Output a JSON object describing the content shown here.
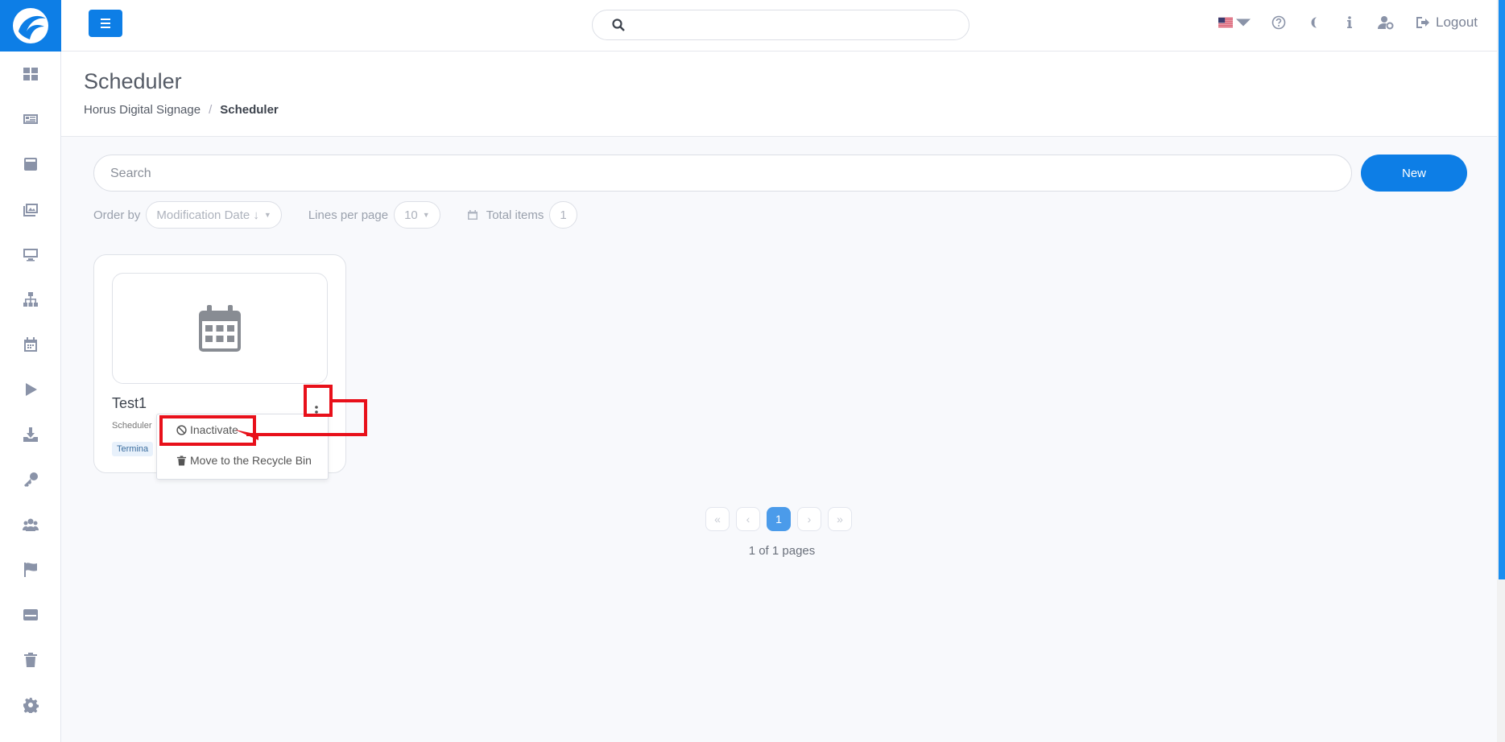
{
  "sidebar": {
    "items": [
      "dashboard-icon",
      "news-icon",
      "layout-icon",
      "media-icon",
      "monitor-icon",
      "sitemap-icon",
      "calendar-icon",
      "play-icon",
      "download-icon",
      "key-icon",
      "users-icon",
      "flag-icon",
      "card-icon",
      "trash-icon",
      "gear-icon"
    ]
  },
  "topbar": {
    "search_placeholder": "",
    "logout_label": "Logout"
  },
  "header": {
    "title": "Scheduler",
    "breadcrumb": [
      "Horus Digital Signage",
      "Scheduler"
    ],
    "breadcrumb_sep": "/"
  },
  "toolbar": {
    "search_placeholder": "Search",
    "new_label": "New",
    "order_by_label": "Order by",
    "order_by_value": "Modification Date ↓",
    "lines_label": "Lines per page",
    "lines_value": "10",
    "total_label": "Total items",
    "total_value": "1"
  },
  "card": {
    "title": "Test1",
    "subtitle": "Scheduler",
    "tag": "Termina"
  },
  "dropdown": {
    "inactivate": "Inactivate",
    "recycle": "Move to the Recycle Bin"
  },
  "pagination": {
    "first": "«",
    "prev": "‹",
    "current": "1",
    "next": "›",
    "last": "»",
    "summary": "1 of 1 pages"
  },
  "colors": {
    "primary": "#0d7ee6",
    "annotation": "#e8101a"
  }
}
